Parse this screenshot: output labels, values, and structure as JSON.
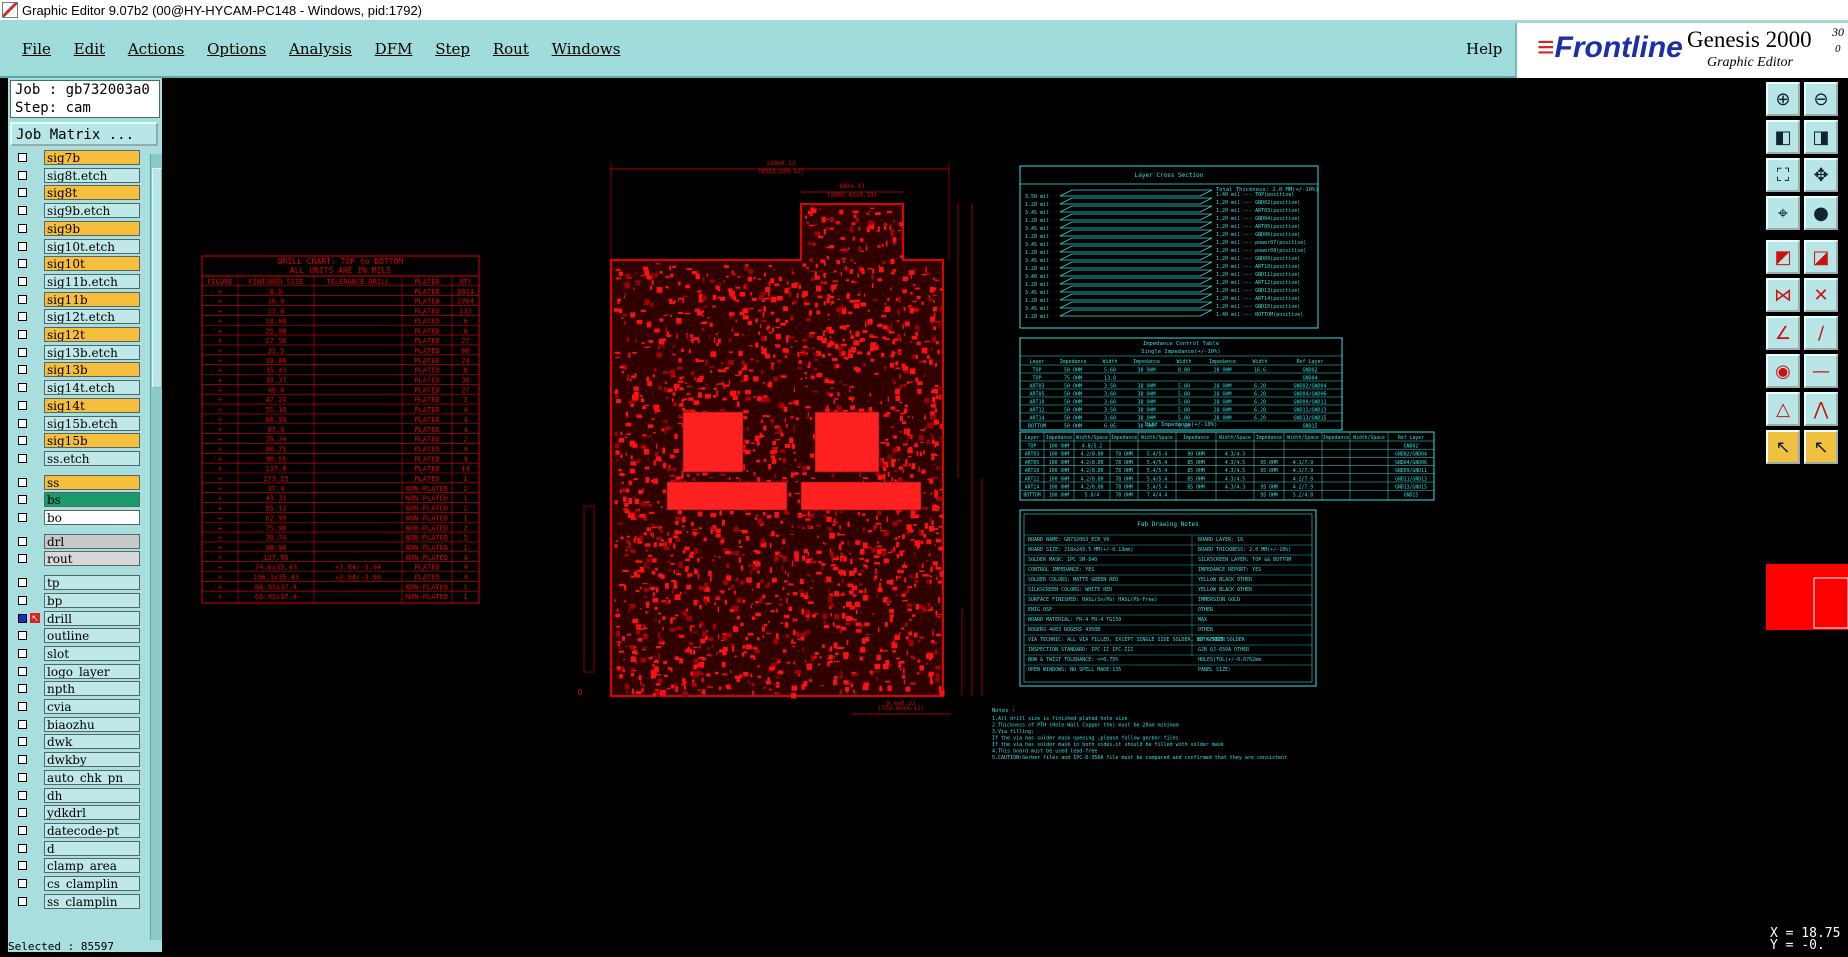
{
  "window": {
    "title": "Graphic Editor 9.07b2 (00@HY-HYCAM-PC148 - Windows, pid:1792)"
  },
  "menu": {
    "items": [
      "File",
      "Edit",
      "Actions",
      "Options",
      "Analysis",
      "DFM",
      "Step",
      "Rout",
      "Windows"
    ],
    "help": "Help"
  },
  "brand": {
    "name": "Frontline",
    "product": "Genesis 2000",
    "version": "30",
    "version_sub": "0",
    "subtitle": "Graphic Editor"
  },
  "job": {
    "job_line": "Job : gb732003a0",
    "step_line": "Step: cam",
    "matrix_button": "Job Matrix ..."
  },
  "layers": [
    {
      "name": "sig7b",
      "color": "#f5be3c"
    },
    {
      "name": "sig8t.etch",
      "color": "#bfe8e8"
    },
    {
      "name": "sig8t",
      "color": "#f5be3c"
    },
    {
      "name": "sig9b.etch",
      "color": "#bfe8e8"
    },
    {
      "name": "sig9b",
      "color": "#f5be3c"
    },
    {
      "name": "sig10t.etch",
      "color": "#bfe8e8"
    },
    {
      "name": "sig10t",
      "color": "#f5be3c"
    },
    {
      "name": "sig11b.etch",
      "color": "#bfe8e8"
    },
    {
      "name": "sig11b",
      "color": "#f5be3c"
    },
    {
      "name": "sig12t.etch",
      "color": "#bfe8e8"
    },
    {
      "name": "sig12t",
      "color": "#f5be3c"
    },
    {
      "name": "sig13b.etch",
      "color": "#bfe8e8"
    },
    {
      "name": "sig13b",
      "color": "#f5be3c"
    },
    {
      "name": "sig14t.etch",
      "color": "#bfe8e8"
    },
    {
      "name": "sig14t",
      "color": "#f5be3c"
    },
    {
      "name": "sig15b.etch",
      "color": "#bfe8e8"
    },
    {
      "name": "sig15b",
      "color": "#f5be3c"
    },
    {
      "name": "ss.etch",
      "color": "#bfe8e8"
    },
    {
      "name": "ss",
      "color": "#f5be3c"
    },
    {
      "name": "bs",
      "color": "#1a9a6a"
    },
    {
      "name": "bo",
      "color": "#ffffff"
    },
    {
      "name": "drl",
      "color": "#c8c8c8"
    },
    {
      "name": "rout",
      "color": "#d8d8d8"
    },
    {
      "name": "tp",
      "color": "#bfe8e8"
    },
    {
      "name": "bp",
      "color": "#bfe8e8"
    },
    {
      "name": "drill",
      "color": "#bfe8e8"
    },
    {
      "name": "outline",
      "color": "#bfe8e8"
    },
    {
      "name": "slot",
      "color": "#bfe8e8"
    },
    {
      "name": "logo_layer_",
      "color": "#bfe8e8"
    },
    {
      "name": "npth",
      "color": "#bfe8e8"
    },
    {
      "name": "cvia",
      "color": "#bfe8e8"
    },
    {
      "name": "biaozhu",
      "color": "#bfe8e8"
    },
    {
      "name": "dwk",
      "color": "#bfe8e8"
    },
    {
      "name": "dwkby",
      "color": "#bfe8e8"
    },
    {
      "name": "auto_chk_pn",
      "color": "#bfe8e8"
    },
    {
      "name": "dh",
      "color": "#bfe8e8"
    },
    {
      "name": "ydkdrl",
      "color": "#bfe8e8"
    },
    {
      "name": "datecode-pt",
      "color": "#bfe8e8"
    },
    {
      "name": "d",
      "color": "#bfe8e8"
    },
    {
      "name": "clamp_area",
      "color": "#bfe8e8"
    },
    {
      "name": "cs_clamplin",
      "color": "#bfe8e8"
    },
    {
      "name": "ss_clamplin",
      "color": "#bfe8e8"
    }
  ],
  "status": {
    "selected": "Selected : 85597"
  },
  "coords": {
    "x": "X = 18.75",
    "y": "Y = -0."
  },
  "drill_chart": {
    "title": "DRILL CHART: TOP to BOTTOM",
    "subtitle": "ALL UNITS ARE IN MILS",
    "headers": [
      "FIGURE",
      "FINISHED_SIZE",
      "TOLERANCE_DRILL",
      "PLATED",
      "QTY"
    ],
    "rows": [
      [
        "+",
        "8.0",
        "",
        "PLATED",
        "9314"
      ],
      [
        "+",
        "10.0",
        "",
        "PLATED",
        "2204"
      ],
      [
        "+",
        "12.0",
        "",
        "PLATED",
        "132"
      ],
      [
        "+",
        "18.60",
        "",
        "PLATED",
        "6"
      ],
      [
        "+",
        "25.98",
        "",
        "PLATED",
        "6"
      ],
      [
        "+",
        "27.56",
        "",
        "PLATED",
        "27"
      ],
      [
        "+",
        "31.5",
        "",
        "PLATED",
        "68"
      ],
      [
        "+",
        "33.86",
        "",
        "PLATED",
        "24"
      ],
      [
        "+",
        "35.43",
        "",
        "PLATED",
        "8"
      ],
      [
        "+",
        "39.37",
        "",
        "PLATED",
        "30"
      ],
      [
        "+",
        "40.0",
        "",
        "PLATED",
        "27"
      ],
      [
        "+",
        "47.24",
        "",
        "PLATED",
        "3"
      ],
      [
        "+",
        "51.18",
        "",
        "PLATED",
        "4"
      ],
      [
        "+",
        "66.93",
        "",
        "PLATED",
        "4"
      ],
      [
        "+",
        "87.0",
        "",
        "PLATED",
        "4"
      ],
      [
        "+",
        "78.74",
        "",
        "PLATED",
        "2"
      ],
      [
        "+",
        "80.71",
        "",
        "PLATED",
        "4"
      ],
      [
        "+",
        "90.55",
        "",
        "PLATED",
        "9"
      ],
      [
        "+",
        "137.8",
        "",
        "PLATED",
        "19"
      ],
      [
        "+",
        "173.23",
        "",
        "PLATED",
        "1"
      ],
      [
        "+",
        "37.4",
        "",
        "NON-PLATED",
        "2"
      ],
      [
        "+",
        "43.31",
        "",
        "NON-PLATED",
        "1"
      ],
      [
        "+",
        "55.12",
        "",
        "NON-PLATED",
        "2"
      ],
      [
        "+",
        "62.99",
        "",
        "NON-PLATED",
        "1"
      ],
      [
        "+",
        "75.98",
        "",
        "NON-PLATED",
        "2"
      ],
      [
        "+",
        "78.74",
        "",
        "NON-PLATED",
        "5"
      ],
      [
        "+",
        "98.98",
        "",
        "NON-PLATED",
        "1"
      ],
      [
        "+",
        "127.95",
        "",
        "NON-PLATED",
        "4"
      ],
      [
        "+",
        "74.6x35.43",
        "+3.94/-3.94",
        "PLATED",
        "4"
      ],
      [
        "+",
        "106.3x35.43",
        "+3.94/-3.94",
        "PLATED",
        "4"
      ],
      [
        "+",
        "66.93x37.4",
        "",
        "NON-PLATED",
        "1"
      ],
      [
        "+",
        "66.93x37.4",
        "",
        "NON-PLATED",
        "1"
      ]
    ]
  },
  "cross_section": {
    "title": "Layer Cross Section",
    "total": "Total Thickness: 2.0 MM(+/-10%)",
    "thickness_labels": [
      "3.50 mil",
      "1.20 mil",
      "3.45 mil",
      "1.20 mil",
      "3.45 mil",
      "1.20 mil",
      "3.45 mil",
      "1.20 mil",
      "3.45 mil",
      "1.20 mil",
      "3.40 mil",
      "1.20 mil",
      "3.45 mil",
      "1.20 mil",
      "3.45 mil",
      "1.20 mil"
    ],
    "layer_labels": [
      "1.40 mil --- TOP(positive)",
      "1.20 mil --- GND02(positive)",
      "1.20 mil --- ART03(positive)",
      "1.20 mil --- GND04(positive)",
      "1.20 mil --- ART05(positive)",
      "1.20 mil --- GND06(positive)",
      "1.20 mil --- power07(positive)",
      "1.20 mil --- power08(positive)",
      "1.20 mil --- GND09(positive)",
      "1.20 mil --- ART10(positive)",
      "1.20 mil --- GND11(positive)",
      "1.20 mil --- ART12(positive)",
      "1.20 mil --- GND13(positive)",
      "1.20 mil --- ART14(positive)",
      "1.20 mil --- GND15(positive)",
      "1.40 mil --- BOTTOM(positive)"
    ]
  },
  "impedance": {
    "title": "Impedance Control Table",
    "single_title": "Single Impedance(+/-10%)",
    "single_headers": [
      "Layer",
      "Impedance",
      "Width",
      "Impedance",
      "Width",
      "Impedance",
      "Width",
      "Ref Layer"
    ],
    "single_rows": [
      [
        "TOP",
        "50 OHM",
        "5.60",
        "38 OHM",
        "8.80",
        "28 OHM",
        "16.6",
        "GND02"
      ],
      [
        "TOP",
        "75 OHM",
        "13.0",
        "",
        "",
        "",
        "",
        "GND04"
      ],
      [
        "ART03",
        "50 OHM",
        "3.50",
        "38 OHM",
        "5.80",
        "28 OHM",
        "6.20",
        "GND02/GND04"
      ],
      [
        "ART05",
        "50 OHM",
        "3.60",
        "38 OHM",
        "5.80",
        "28 OHM",
        "6.20",
        "GND04/GND06"
      ],
      [
        "ART10",
        "50 OHM",
        "3.60",
        "38 OHM",
        "5.80",
        "28 OHM",
        "6.20",
        "GND09/GND11"
      ],
      [
        "ART12",
        "50 OHM",
        "3.50",
        "38 OHM",
        "5.80",
        "28 OHM",
        "6.20",
        "GND11/GND13"
      ],
      [
        "ART14",
        "50 OHM",
        "3.60",
        "38 OHM",
        "5.80",
        "28 OHM",
        "6.20",
        "GND13/GND15"
      ],
      [
        "BOTTOM",
        "50 OHM",
        "6.05",
        "38 OHM",
        "9.80",
        "",
        "",
        "GND15"
      ]
    ],
    "diff_title": "Diff Impedance(+/-10%)",
    "diff_headers": [
      "Layer",
      "Impedance",
      "Width/Space",
      "Impedance",
      "Width/Space",
      "Impedance",
      "Width/Space",
      "Impedance",
      "Width/Space",
      "Impedance",
      "Width/Space",
      "Ref Layer"
    ],
    "diff_rows": [
      [
        "TOP",
        "100 OHM",
        "4.8/5.2",
        "",
        "",
        "",
        "",
        "",
        "",
        "",
        "",
        "GND02"
      ],
      [
        "ART03",
        "100 OHM",
        "4.2/8.80",
        "78 OHM",
        "5.4/5.4",
        "90 OHM",
        "4.3/4.3",
        "",
        "",
        "",
        "",
        "GND02/GND04"
      ],
      [
        "ART05",
        "100 OHM",
        "4.2/8.80",
        "78 OHM",
        "5.4/5.4",
        "85 OHM",
        "4.3/4.5",
        "95 OHM",
        "4.1/7.9",
        "",
        "",
        "GND04/GND06"
      ],
      [
        "ART10",
        "100 OHM",
        "4.2/8.80",
        "78 OHM",
        "5.4/5.4",
        "85 OHM",
        "4.3/4.5",
        "95 OHM",
        "4.1/7.9",
        "",
        "",
        "GND09/GND11"
      ],
      [
        "ART12",
        "100 OHM",
        "4.2/8.80",
        "78 OHM",
        "5.4/5.4",
        "85 OHM",
        "4.3/4.5",
        "",
        "4.2/7.9",
        "",
        "",
        "GND11/GND13"
      ],
      [
        "ART14",
        "100 OHM",
        "4.2/8.80",
        "78 OHM",
        "5.4/5.4",
        "85 OHM",
        "4.3/4.3",
        "95 OHM",
        "4.2/7.9",
        "",
        "",
        "GND13/GND15"
      ],
      [
        "BOTTOM",
        "100 OHM",
        "5.0/4",
        "78 OHM",
        "7.4/4.4",
        "",
        "",
        "95 OHM",
        "5.2/4.8",
        "",
        "",
        "GND15"
      ]
    ]
  },
  "fab_notes": {
    "title": "Fab Drawing Notes",
    "rows": [
      [
        "BOARD NAME: GB732003_ECB_V0",
        "BOARD LAYER: 16"
      ],
      [
        "BOARD SIZE: 218x243.5 MM(+/-0.13mm)",
        "BOARD THICKNESS: 2.0 MM(+/-10%)"
      ],
      [
        "SOLDER MASK: IPC SM-840",
        "SILKSCREEN LAYER: TOP && BOTTOM"
      ],
      [
        "CONTROL IMPEDANCE: YES",
        "IMPEDANCE REPORT: YES"
      ],
      [
        "SOLDER COLORS: MATTE GREEN   RED",
        "YELLOW   BLACK   OTHER"
      ],
      [
        "SILKSCREEN COLORS: WHITE   RED",
        "YELLOW   BLACK   OTHER"
      ],
      [
        "SURFACE FINISHED: HASL(Sn/Pb)   HASL(Pb-Free)",
        "IMMERSION GOLD"
      ],
      [
        "ENIG   OSP",
        "OTHER"
      ],
      [
        "BOARD MATERIAL:   FR-4   FR-4 TG150",
        "MAX"
      ],
      [
        "ROGERS 4003   ROGERS 4350B",
        "OTHER"
      ],
      [
        "VIA TECHNIC: ALL VIA FILLED, EXCEPT SINGLE SIDE SOLDER, BOTH SIDE SOLDER",
        "BY GERBER"
      ],
      [
        "INSPECTION STANDARD:  IPC-II   IPC-III",
        "GJB   QJ-650A   OTHER"
      ],
      [
        "BOW & TWIST TOLERANCE: <=0.75%",
        "HOLES(TOL)+/-0.0762mm"
      ],
      [
        "OPEN WINDOWS: NO   SPELL MADE:135",
        "PANEL SIZE:"
      ]
    ]
  },
  "notes": {
    "heading": "Notes :",
    "lines": [
      "1.All drill size is finished plated hole size",
      "2.Thickness of PTH (Hole Wall Copper thk) must be 20um minimum",
      "3.Via filling:",
      "  If the via has solder mask opening ,please follow gerber files",
      "  If the via has solder mask in both sides,it should be filled with solder mask",
      "4.This board must be used lead-free",
      "5.CAUTION:Gerber files and IPC-D-356A file must be compared and confirmed that they are consistent"
    ]
  },
  "board_dims": {
    "top_width": "218x0.13",
    "top_width_sub": "(8583.5x0.13)",
    "notch_width": "68x0.13",
    "notch_sub": "(2680.42x0.13)",
    "bottom_width": "9.6x0.13",
    "bottom_sub": "(378.09x0.13)",
    "zero": "0"
  },
  "colors": {
    "panel_bg": "#a8dede",
    "accent_red": "#e00000",
    "cyan_text": "#30e0e0",
    "menubar": "#a0dcdc"
  }
}
